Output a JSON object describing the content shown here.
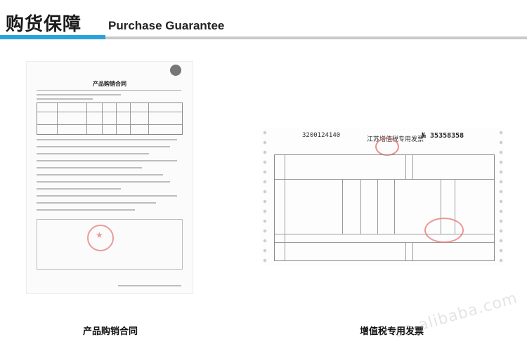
{
  "header": {
    "title_cn": "购货保障",
    "title_en": "Purchase Guarantee",
    "accent_color": "#2aa3d9"
  },
  "documents": {
    "contract": {
      "heading": "产品购销合同",
      "caption": "产品购销合同"
    },
    "invoice": {
      "code": "3200124140",
      "title": "江苏增值税专用发票",
      "number": "№ 35358358",
      "caption": "增值税专用发票"
    }
  },
  "watermark": {
    "text": "cn-alibaba.com"
  }
}
